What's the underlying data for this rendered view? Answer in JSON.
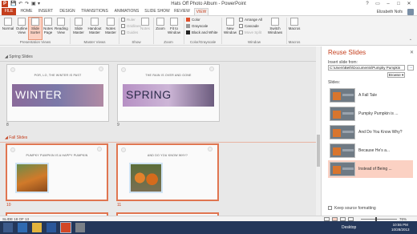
{
  "window": {
    "title": "Hats Off Photo Album - PowerPoint",
    "app_icon": "P",
    "controls": [
      "?",
      "▭",
      "–",
      "□",
      "✕"
    ]
  },
  "qat": [
    "save-icon",
    "undo-icon",
    "redo-icon",
    "start-icon",
    "customize-icon"
  ],
  "tabs": [
    "FILE",
    "HOME",
    "INSERT",
    "DESIGN",
    "TRANSITIONS",
    "ANIMATIONS",
    "SLIDE SHOW",
    "REVIEW",
    "VIEW"
  ],
  "active_tab": "VIEW",
  "user": {
    "name": "Elizabeth Nofs"
  },
  "ribbon": {
    "presentation_views": {
      "label": "Presentation Views",
      "buttons": [
        "Normal",
        "Outline View",
        "Slide Sorter",
        "Notes Page",
        "Reading View"
      ]
    },
    "master_views": {
      "label": "Master Views",
      "buttons": [
        "Slide Master",
        "Handout Master",
        "Notes Master"
      ]
    },
    "show": {
      "label": "Show",
      "items": [
        "Ruler",
        "Gridlines",
        "Guides"
      ],
      "notes": "Notes"
    },
    "zoom": {
      "label": "Zoom",
      "buttons": [
        "Zoom",
        "Fit to Window"
      ]
    },
    "color": {
      "label": "Color/Grayscale",
      "items": [
        "Color",
        "Grayscale",
        "Black and White"
      ]
    },
    "window": {
      "label": "Window",
      "new_window": "New Window",
      "items": [
        "Arrange All",
        "Cascade",
        "Move Split"
      ]
    },
    "switch": "Switch Windows",
    "macros": {
      "label": "Macros",
      "button": "Macros"
    }
  },
  "sections": [
    {
      "name": "Spring Slides",
      "slides": [
        {
          "number": "8",
          "caption": "POR, LO, THE WINTER IS PAST",
          "title": "WINTER"
        },
        {
          "number": "9",
          "caption": "THE RAIN IS OVER AND GONE",
          "title": "SPRING"
        }
      ]
    },
    {
      "name": "Fall Slides",
      "slides": [
        {
          "number": "10",
          "caption": "PUMPKY PUMPKIN IS A HAPPY PUMPKIN"
        },
        {
          "number": "11",
          "caption": "AND DO YOU KNOW WHY?"
        }
      ]
    }
  ],
  "reuse_pane": {
    "title": "Reuse Slides",
    "close": "✕",
    "insert_from_label": "Insert slide from:",
    "path": "C:\\Users\\Beth\\Documents\\Pumpky Pumpkin",
    "go": "→",
    "browse": "Browse ▾",
    "slides_label": "Slides:",
    "slides": [
      "A Fall Tale",
      "Pumpky Pumpkin is ...",
      "And Do You Know Why?",
      "Because He's a...",
      "Instead of Being ..."
    ],
    "highlighted_index": 4,
    "keep_source": "Keep source formatting"
  },
  "status": {
    "slide_count": "SLIDE 18 OF 13",
    "zoom": "76%"
  },
  "taskbar": {
    "desktop": "Desktop",
    "time": "10:55 PM",
    "date": "10/28/2013"
  },
  "colors": {
    "accent": "#c43e1c",
    "selection": "#e07550",
    "taskbar": "#24375a"
  }
}
